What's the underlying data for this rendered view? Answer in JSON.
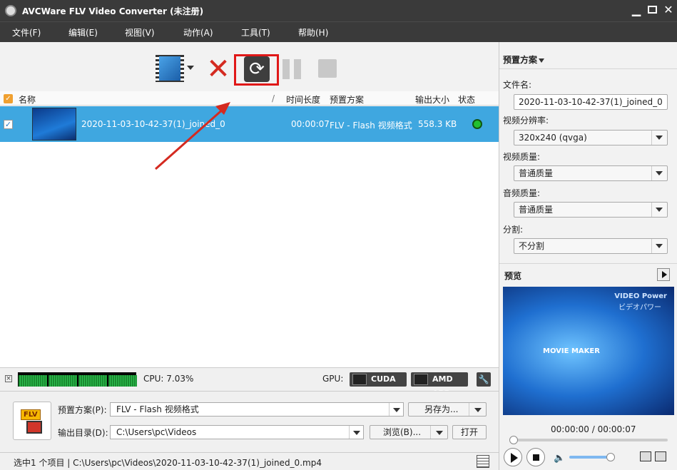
{
  "window": {
    "title": "AVCWare FLV Video Converter (未注册)"
  },
  "menu": [
    "文件(F)",
    "编辑(E)",
    "视图(V)",
    "动作(A)",
    "工具(T)",
    "帮助(H)"
  ],
  "list": {
    "headers": {
      "name": "名称",
      "sort_mark": "/",
      "duration": "时间长度",
      "preset": "预置方案",
      "size": "输出大小",
      "status": "状态"
    },
    "rows": [
      {
        "checked": "✓",
        "name": "2020-11-03-10-42-37(1)_joined_0",
        "duration": "00:00:07",
        "preset": "FLV - Flash 视频格式",
        "size": "558.3 KB"
      }
    ]
  },
  "cpu": {
    "label": "CPU: 7.03%",
    "gpu_label": "GPU:",
    "cuda": "CUDA",
    "amd": "AMD APP"
  },
  "bottom": {
    "preset_label": "预置方案(P):",
    "preset_value": "FLV - Flash 视频格式",
    "save_as": "另存为...",
    "output_label": "输出目录(D):",
    "output_value": "C:\\Users\\pc\\Videos",
    "browse": "浏览(B)...",
    "open": "打开",
    "flv_tag": "FLV"
  },
  "status": {
    "text": "选中1 个项目 | C:\\Users\\pc\\Videos\\2020-11-03-10-42-37(1)_joined_0.mp4"
  },
  "right": {
    "header": "预置方案",
    "filename_label": "文件名:",
    "filename_value": "2020-11-03-10-42-37(1)_joined_0",
    "resolution_label": "视频分辨率:",
    "resolution_value": "320x240 (qvga)",
    "vquality_label": "视频质量:",
    "vquality_value": "普通质量",
    "aquality_label": "音频质量:",
    "aquality_value": "普通质量",
    "split_label": "分割:",
    "split_value": "不分割",
    "preview_label": "预览",
    "preview_wm1": "VIDEO Power",
    "preview_wm2": "ビデオパワー",
    "preview_mm": "MOVIE MAKER",
    "time": "00:00:00 / 00:00:07",
    "seek_fraction": 0,
    "volume_fraction": 0.9
  },
  "colors": {
    "accent_row": "#3fa7e0",
    "highlight_frame": "#e01818",
    "arrow": "#d42a20"
  }
}
